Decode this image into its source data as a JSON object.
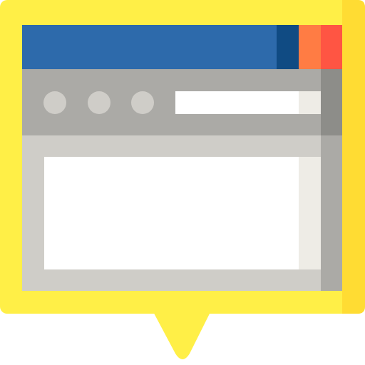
{
  "icon": {
    "name": "browser-window-speech-bubble-icon",
    "colors": {
      "bubble": "#FFEF47",
      "bubble_shade": "#FFDC33",
      "title_bar": "#2D6AAB",
      "title_bar_dark": "#104B83",
      "title_bar_orange": "#FF7C44",
      "title_bar_red": "#FF5543",
      "toolbar": "#ABAAA6",
      "toolbar_shade": "#8D8D89",
      "window_dot": "#CFCDC8",
      "address_bar": "#FFFFFF",
      "address_bar_shade": "#EEECE6",
      "content_frame": "#CFCDC8",
      "content_frame_shade": "#ABAAA6",
      "content_area": "#FFFFFF",
      "content_area_shade": "#EEECE6"
    }
  }
}
